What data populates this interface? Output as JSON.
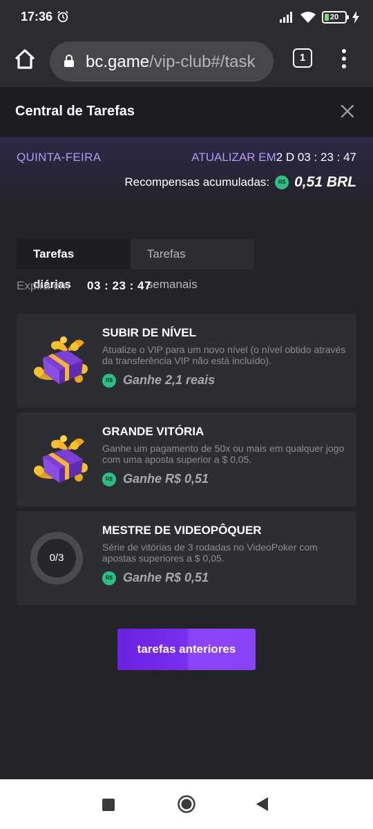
{
  "status_bar": {
    "time": "17:36",
    "battery": "20",
    "battery_level": 0.2,
    "icons": [
      "alarm-icon",
      "signal-icon",
      "wifi-icon",
      "battery-icon",
      "charging-icon"
    ]
  },
  "browser": {
    "url_domain": "bc.game",
    "url_path": "/vip-club#/task",
    "tab_count": "1"
  },
  "modal": {
    "title": "Central de Tarefas"
  },
  "banner": {
    "day": "QUINTA-FEIRA",
    "refresh_label": "ATUALIZAR EM",
    "refresh_value": "2 D 03 : 23 : 47",
    "rewards_label": "Recompensas acumuladas:",
    "rewards_value": "0,51 BRL"
  },
  "currency_badge": "R$",
  "tabs": [
    {
      "label": "Tarefas diárias",
      "active": true
    },
    {
      "label": "Tarefas semanais",
      "active": false
    }
  ],
  "expire": {
    "label": "Expira em",
    "value": "03 : 23 : 47"
  },
  "tasks": [
    {
      "title": "SUBIR DE NÍVEL",
      "description": "Atualize o VIP para um novo nível (o nível obtido através da transferência VIP não está incluído).",
      "reward": "Ganhe 2,1 reais",
      "icon": "gift-box-icon"
    },
    {
      "title": "GRANDE VITÓRIA",
      "description": "Ganhe um pagamento de 50x ou mais em qualquer jogo com uma aposta superior a $ 0,05.",
      "reward": "Ganhe R$ 0,51",
      "icon": "gift-box-icon"
    },
    {
      "title": "MESTRE DE VIDEOPÔQUER",
      "description": "Série de vitórias de 3 rodadas no VideoPoker com apostas superiores a $ 0,05.",
      "reward": "Ganhe R$ 0,51",
      "progress": "0/3",
      "progress_fraction": 0
    }
  ],
  "previous_button": "tarefas anteriores",
  "colors": {
    "accent": "#b69af5",
    "button": "#7a2ef0",
    "coin": "#2dbf84",
    "background": "#232427"
  }
}
